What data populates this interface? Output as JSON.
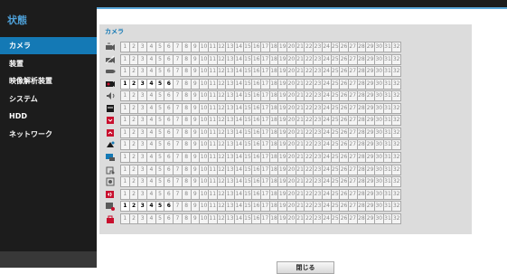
{
  "sidebar": {
    "title": "状態",
    "items": [
      {
        "label": "カメラ",
        "active": true
      },
      {
        "label": "装置",
        "active": false
      },
      {
        "label": "映像解析装置",
        "active": false
      },
      {
        "label": "システム",
        "active": false
      },
      {
        "label": "HDD",
        "active": false
      },
      {
        "label": "ネットワーク",
        "active": false
      }
    ]
  },
  "panel": {
    "label": "カメラ",
    "channel_numbers": [
      "1",
      "2",
      "3",
      "4",
      "5",
      "6",
      "7",
      "8",
      "9",
      "10",
      "11",
      "12",
      "13",
      "14",
      "15",
      "16",
      "17",
      "18",
      "19",
      "20",
      "21",
      "22",
      "23",
      "24",
      "25",
      "26",
      "27",
      "28",
      "29",
      "30",
      "31",
      "32"
    ],
    "rows": [
      {
        "icon": "camera-connection-icon",
        "icon_color": "#5a5a5a",
        "active_channels": []
      },
      {
        "icon": "camera-disconnected-icon",
        "icon_color": "#5a5a5a",
        "active_channels": []
      },
      {
        "icon": "record-icon",
        "icon_color": "#5a5a5a",
        "active_channels": []
      },
      {
        "icon": "video-recording-icon",
        "icon_color": "#1a1a1a",
        "active_channels": [
          1,
          2,
          3,
          4,
          5,
          6
        ]
      },
      {
        "icon": "audio-icon",
        "icon_color": "#5a5a5a",
        "active_channels": []
      },
      {
        "icon": "video-loss-icon",
        "icon_color": "#1a1a1a",
        "active_channels": []
      },
      {
        "icon": "alarm-in-icon",
        "icon_color": "#c8102e",
        "active_channels": []
      },
      {
        "icon": "alarm-out-icon",
        "icon_color": "#c8102e",
        "active_channels": []
      },
      {
        "icon": "motion-icon",
        "icon_color": "#1a1a1a",
        "active_channels": []
      },
      {
        "icon": "video-analytics-icon",
        "icon_color": "#1479b5",
        "active_channels": []
      },
      {
        "icon": "tampering-icon",
        "icon_color": "#5a5a5a",
        "active_channels": []
      },
      {
        "icon": "face-detection-icon",
        "icon_color": "#5a5a5a",
        "active_channels": []
      },
      {
        "icon": "audio-detection-icon",
        "icon_color": "#c8102e",
        "active_channels": []
      },
      {
        "icon": "event-recording-icon",
        "icon_color": "#5a5a5a",
        "active_channels": [
          1,
          2,
          3,
          4,
          5,
          6
        ]
      },
      {
        "icon": "lock-icon",
        "icon_color": "#c8102e",
        "active_channels": []
      }
    ]
  },
  "footer": {
    "close_label": "閉じる"
  }
}
